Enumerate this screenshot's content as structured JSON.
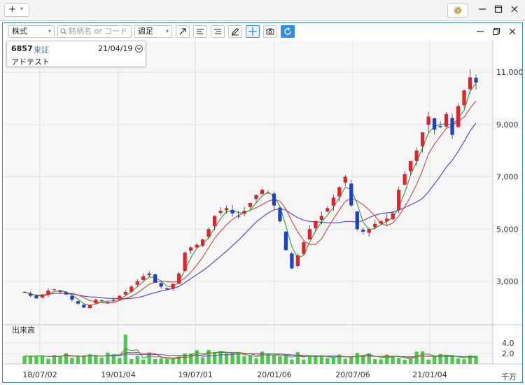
{
  "window": {
    "add_label": "+",
    "settings_icon": "gear-icon"
  },
  "toolbar": {
    "asset_type": "株式",
    "search_placeholder": "銘柄名 or コード",
    "period": "週足",
    "tools": [
      "arrow-icon",
      "indicator-left-icon",
      "indicator-right-icon",
      "pen-icon",
      "crosshair-icon",
      "camera-icon",
      "refresh-icon"
    ]
  },
  "info": {
    "code": "6857",
    "market": "東証",
    "date": "21/04/19",
    "name": "アドテスト"
  },
  "volume_panel": {
    "label": "出来高",
    "unit": "千万"
  },
  "colors": {
    "up": "#e8202a",
    "down": "#1f3fd0",
    "ma_short": "#2aa02a",
    "ma_mid": "#e04040",
    "ma_long": "#5a48d6",
    "volume": "#4fc64f",
    "accent": "#3a8ee0"
  },
  "chart_data": [
    {
      "type": "candlestick",
      "title": "",
      "y_ticks": [
        "11,000",
        "9,000",
        "7,000",
        "5,000",
        "3,000"
      ],
      "y_tick_values": [
        11000,
        9000,
        7000,
        5000,
        3000
      ],
      "ylim": [
        1700,
        11400
      ],
      "x_ticks": [
        "18/07/02",
        "19/01/04",
        "19/07/01",
        "20/01/06",
        "20/07/06",
        "21/01/04"
      ],
      "x_range": [
        "2018-06",
        "2021-04-19"
      ],
      "series": [
        {
          "name": "",
          "kind": "moving-average-short"
        },
        {
          "name": "",
          "kind": "moving-average-mid"
        },
        {
          "name": "",
          "kind": "moving-average-long"
        }
      ],
      "closes_approx": [
        2600,
        2450,
        2350,
        2500,
        2650,
        2700,
        2600,
        2500,
        2300,
        2150,
        2000,
        2100,
        2300,
        2250,
        2200,
        2300,
        2450,
        2600,
        2800,
        3000,
        3200,
        3300,
        2950,
        2800,
        2700,
        2900,
        3300,
        4100,
        4300,
        4400,
        4600,
        5000,
        5500,
        5700,
        5800,
        5600,
        5500,
        5700,
        6000,
        6300,
        6500,
        6400,
        5900,
        5300,
        4200,
        3500,
        4000,
        4500,
        5000,
        5300,
        5500,
        5800,
        6200,
        6600,
        7000,
        5900,
        5000,
        4900,
        5000,
        5200,
        5300,
        5400,
        5600,
        6500,
        7100,
        7600,
        8000,
        8700,
        9300,
        8800,
        8900,
        9400,
        8600,
        9700,
        10300,
        10800,
        10600
      ]
    },
    {
      "type": "bar",
      "title": "",
      "y_ticks": [
        "4.0",
        "2.0"
      ],
      "y_tick_values": [
        4.0,
        2.0
      ],
      "unit": "千万",
      "ylim": [
        0,
        5.2
      ]
    }
  ]
}
